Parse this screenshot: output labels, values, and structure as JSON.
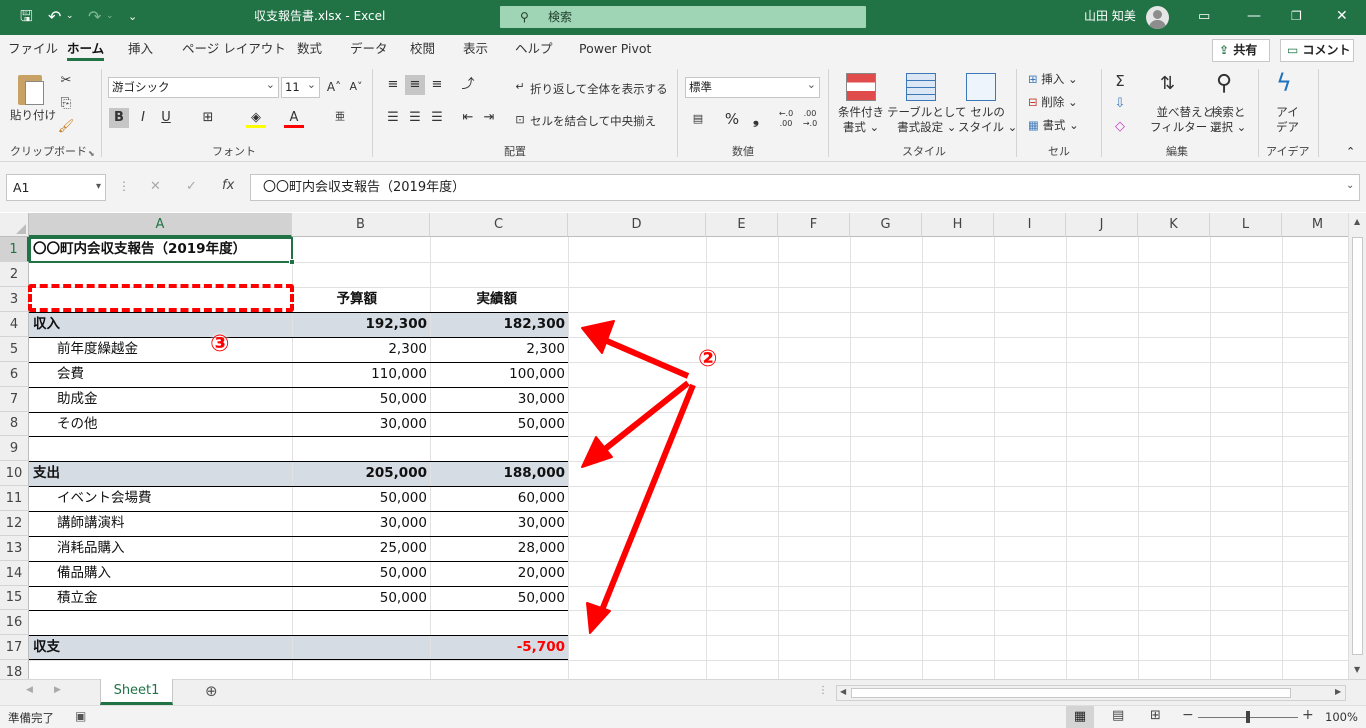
{
  "title_bar": {
    "file_title": "収支報告書.xlsx  -  Excel",
    "search_placeholder": "検索",
    "user_name": "山田 知美"
  },
  "menu": {
    "tabs": [
      "ファイル",
      "ホーム",
      "挿入",
      "ページ レイアウト",
      "数式",
      "データ",
      "校閲",
      "表示",
      "ヘルプ",
      "Power Pivot"
    ],
    "share_label": "共有",
    "comment_label": "コメント"
  },
  "ribbon": {
    "clipboard": {
      "paste": "貼り付け",
      "group": "クリップボード"
    },
    "font": {
      "name": "游ゴシック",
      "size": "11",
      "group": "フォント"
    },
    "alignment": {
      "wrap": "折り返して全体を表示する",
      "merge": "セルを結合して中央揃え",
      "group": "配置"
    },
    "number": {
      "format": "標準",
      "group": "数値"
    },
    "styles": {
      "cond": "条件付き",
      "cond2": "書式",
      "table": "テーブルとして",
      "table2": "書式設定",
      "cell": "セルの",
      "cell2": "スタイル",
      "group": "スタイル"
    },
    "cells": {
      "insert": "挿入",
      "delete": "削除",
      "format": "書式",
      "group": "セル"
    },
    "editing": {
      "sort": "並べ替えと",
      "sort2": "フィルター",
      "find": "検索と",
      "find2": "選択",
      "group": "編集"
    },
    "ideas": {
      "label": "アイ",
      "label2": "デア",
      "group": "アイデア"
    }
  },
  "formula_bar": {
    "name_box": "A1",
    "content": "〇〇町内会収支報告（2019年度）"
  },
  "columns": [
    "A",
    "B",
    "C",
    "D",
    "E",
    "F",
    "G",
    "H",
    "I",
    "J",
    "K",
    "L",
    "M"
  ],
  "rows": [
    "1",
    "2",
    "3",
    "4",
    "5",
    "6",
    "7",
    "8",
    "9",
    "10",
    "11",
    "12",
    "13",
    "14",
    "15",
    "16",
    "17",
    "18"
  ],
  "sheet": {
    "title": "〇〇町内会収支報告（2019年度）",
    "header_budget": "予算額",
    "header_actual": "実績額",
    "income_label": "収入",
    "income_budget": "192,300",
    "income_actual": "182,300",
    "income_items": [
      {
        "name": "前年度繰越金",
        "budget": "2,300",
        "actual": "2,300"
      },
      {
        "name": "会費",
        "budget": "110,000",
        "actual": "100,000"
      },
      {
        "name": "助成金",
        "budget": "50,000",
        "actual": "30,000"
      },
      {
        "name": "その他",
        "budget": "30,000",
        "actual": "50,000"
      }
    ],
    "expense_label": "支出",
    "expense_budget": "205,000",
    "expense_actual": "188,000",
    "expense_items": [
      {
        "name": "イベント会場費",
        "budget": "50,000",
        "actual": "60,000"
      },
      {
        "name": "講師講演料",
        "budget": "30,000",
        "actual": "30,000"
      },
      {
        "name": "消耗品購入",
        "budget": "25,000",
        "actual": "28,000"
      },
      {
        "name": "備品購入",
        "budget": "50,000",
        "actual": "20,000"
      },
      {
        "name": "積立金",
        "budget": "50,000",
        "actual": "50,000"
      }
    ],
    "balance_label": "収支",
    "balance_actual": "-5,700"
  },
  "annotations": {
    "marker_2": "②",
    "marker_3": "③"
  },
  "sheet_tabs": {
    "active": "Sheet1"
  },
  "status": {
    "ready": "準備完了",
    "zoom": "100%"
  },
  "colors": {
    "accent": "#217346",
    "row_fill": "#d6dce4",
    "arrow": "#ff0000",
    "negative": "#ff0000"
  }
}
